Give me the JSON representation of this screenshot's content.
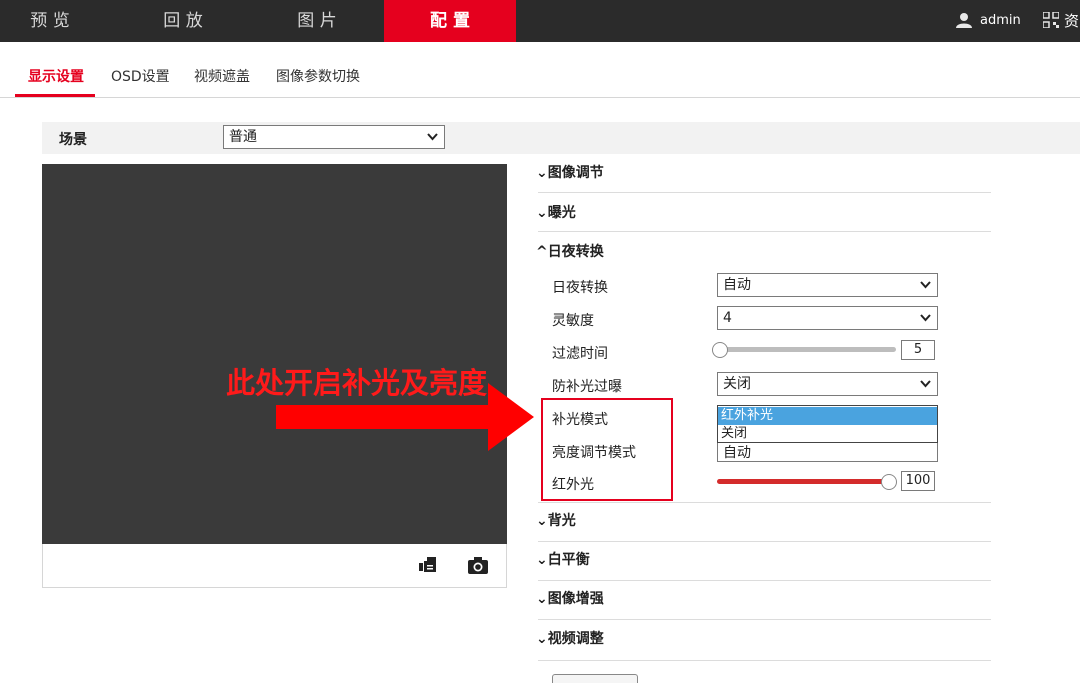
{
  "nav": {
    "items": [
      {
        "label": "预 览"
      },
      {
        "label": "回 放"
      },
      {
        "label": "图 片"
      },
      {
        "label": "配 置"
      }
    ],
    "user": "admin",
    "more": "资"
  },
  "subtabs": [
    {
      "label": "显示设置"
    },
    {
      "label": "OSD设置"
    },
    {
      "label": "视频遮盖"
    },
    {
      "label": "图像参数切换"
    }
  ],
  "scene": {
    "label": "场景",
    "value": "普通"
  },
  "sections": {
    "image_adjust": "图像调节",
    "exposure": "曝光",
    "day_night": "日夜转换",
    "backlight": "背光",
    "white_balance": "白平衡",
    "enhance": "图像增强",
    "video_adjust": "视频调整"
  },
  "day_night": {
    "switch_label": "日夜转换",
    "switch_value": "自动",
    "sensitivity_label": "灵敏度",
    "sensitivity_value": "4",
    "filter_time_label": "过滤时间",
    "filter_time_value": "5",
    "filter_time_fraction": 0.0,
    "anti_overexposure_label": "防补光过曝",
    "anti_overexposure_value": "关闭",
    "fill_mode_label": "补光模式",
    "fill_mode_options": [
      "红外补光",
      "关闭"
    ],
    "brightness_mode_label": "亮度调节模式",
    "brightness_mode_value": "自动",
    "ir_label": "红外光",
    "ir_value": "100",
    "ir_fraction": 1.0
  },
  "annotation": {
    "text": "此处开启补光及亮度"
  },
  "colors": {
    "accent": "#e5001e",
    "nav_bg": "#2b2b2b",
    "dropdown_highlight": "#4aa3df"
  }
}
